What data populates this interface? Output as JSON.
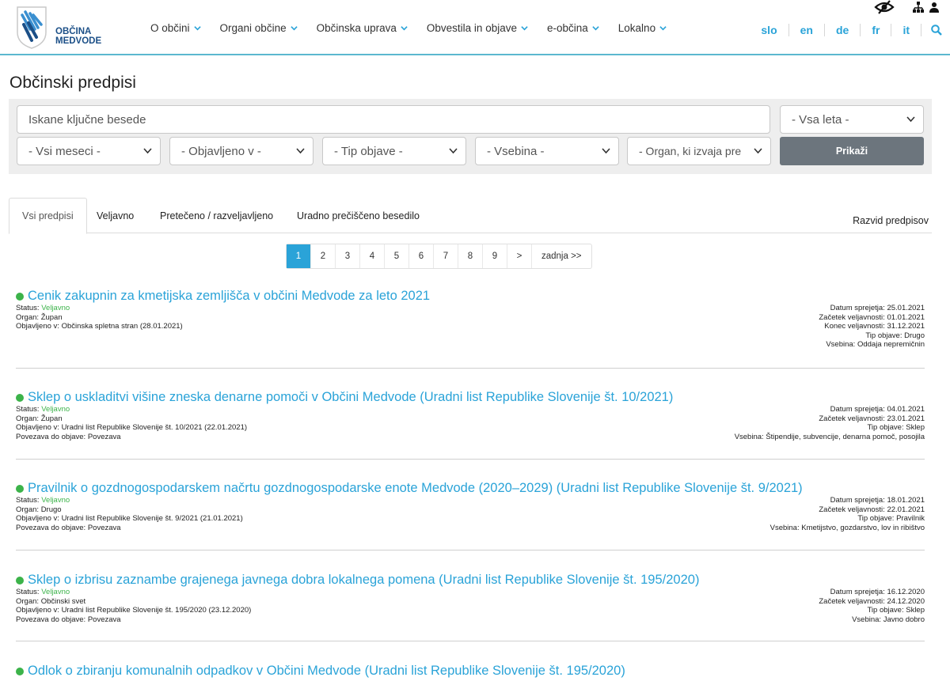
{
  "header": {
    "logo_line1": "OBČINA",
    "logo_line2": "MEDVODE",
    "nav": [
      "O občini",
      "Organi občine",
      "Občinska uprava",
      "Obvestila in objave",
      "e-občina",
      "Lokalno"
    ],
    "languages": [
      "slo",
      "en",
      "de",
      "fr",
      "it"
    ],
    "icons": [
      "accessibility-eye-icon",
      "sitemap-icon",
      "user-icon",
      "search-icon"
    ]
  },
  "page": {
    "title": "Občinski predpisi"
  },
  "filters": {
    "keywords_placeholder": "Iskane ključne besede",
    "year": "- Vsa leta -",
    "month": "- Vsi meseci -",
    "published_in": "- Objavljeno v -",
    "type": "- Tip objave -",
    "content": "- Vsebina -",
    "organ": "- Organ, ki izvaja pre",
    "submit": "Prikaži"
  },
  "tabs": {
    "items": [
      "Vsi predpisi",
      "Veljavno",
      "Pretečeno / razveljavljeno",
      "Uradno prečiščeno besedilo"
    ],
    "right": "Razvid predpisov"
  },
  "pagination": {
    "pages": [
      "1",
      "2",
      "3",
      "4",
      "5",
      "6",
      "7",
      "8",
      "9"
    ],
    "next": ">",
    "last": "zadnja >>",
    "current": "1"
  },
  "labels": {
    "status": "Status:",
    "organ": "Organ:",
    "published": "Objavljeno v:",
    "link": "Povezava do objave:",
    "adopted": "Datum sprejetja:",
    "valid_from": "Začetek veljavnosti:",
    "valid_to": "Konec veljavnosti:",
    "type": "Tip objave:",
    "content": "Vsebina:"
  },
  "records": [
    {
      "title": "Cenik zakupnin za kmetijska zemljišča v občini Medvode za leto 2021",
      "status": "Veljavno",
      "organ": "Župan",
      "published": "Občinska spletna stran (28.01.2021)",
      "link": "",
      "adopted": "25.01.2021",
      "valid_from": "01.01.2021",
      "valid_to": "31.12.2021",
      "type": "Drugo",
      "content": "Oddaja nepremičnin"
    },
    {
      "title": "Sklep o uskladitvi višine zneska denarne pomoči v Občini Medvode (Uradni list Republike Slovenije št. 10/2021)",
      "status": "Veljavno",
      "organ": "Župan",
      "published": "Uradni list Republike Slovenije št. 10/2021 (22.01.2021)",
      "link": "Povezava",
      "adopted": "04.01.2021",
      "valid_from": "23.01.2021",
      "valid_to": "",
      "type": "Sklep",
      "content": "Štipendije, subvencije, denarna pomoč, posojila"
    },
    {
      "title": "Pravilnik o gozdnogospodarskem načrtu gozdnogospodarske enote Medvode (2020–2029) (Uradni list Republike Slovenije št. 9/2021)",
      "status": "Veljavno",
      "organ": "Drugo",
      "published": "Uradni list Republike Slovenije št. 9/2021 (21.01.2021)",
      "link": "Povezava",
      "adopted": "18.01.2021",
      "valid_from": "22.01.2021",
      "valid_to": "",
      "type": "Pravilnik",
      "content": "Kmetijstvo, gozdarstvo, lov in ribištvo"
    },
    {
      "title": "Sklep o izbrisu zaznambe grajenega javnega dobra lokalnega pomena (Uradni list Republike Slovenije št. 195/2020)",
      "status": "Veljavno",
      "organ": "Občinski svet",
      "published": "Uradni list Republike Slovenije št. 195/2020 (23.12.2020)",
      "link": "Povezava",
      "adopted": "16.12.2020",
      "valid_from": "24.12.2020",
      "valid_to": "",
      "type": "Sklep",
      "content": "Javno dobro"
    },
    {
      "title": "Odlok o zbiranju komunalnih odpadkov v Občini Medvode (Uradni list Republike Slovenije št. 195/2020)"
    }
  ]
}
